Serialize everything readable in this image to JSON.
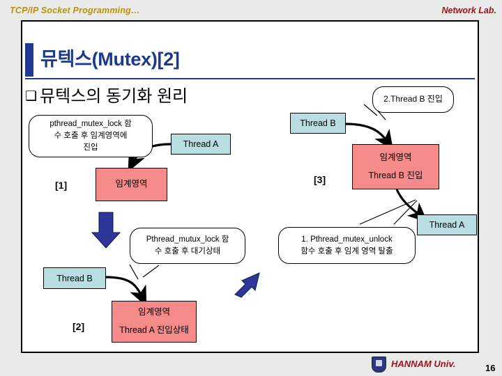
{
  "header": {
    "left": "TCP/IP Socket Programming…",
    "right": "Network Lab."
  },
  "slide": {
    "title": "뮤텍스(Mutex)[2]",
    "section_bullet": "❑",
    "section_heading": "뮤텍스의 동기화 원리"
  },
  "diagram": {
    "steps": {
      "one": "[1]",
      "two": "[2]",
      "three": "[3]"
    },
    "threads": {
      "a_top": "Thread A",
      "a_right": "Thread A",
      "b_top": "Thread B",
      "b_bottom": "Thread B"
    },
    "critical_sections": {
      "cs1_line1": "임계영역",
      "cs1_line2": "",
      "cs2_line1": "임계영역",
      "cs2_line2": "Thread A 진입상태",
      "cs3_line1": "임계영역",
      "cs3_line2": "Thread B 진입"
    },
    "callouts": {
      "lock_enter": "pthread_mutex_lock 함\n수 호출 후 임계영역에\n진입",
      "lock_wait": "Pthread_mutux_lock 함\n수 호출 후 대기상태",
      "unlock_exit": "1. Pthread_mutex_unlock\n함수 호출 후 임계 영역 탈출",
      "thread_b_enter": "2.Thread B 진입"
    }
  },
  "footer": {
    "university": "HANNAM Univ.",
    "page_number": "16"
  },
  "colors": {
    "title_blue": "#1b3a8f",
    "thread_fill": "#b8dde2",
    "critical_fill": "#f58a8a",
    "arrow_blue": "#2f3699",
    "header_gold": "#b79209",
    "lab_red": "#9c1421"
  }
}
